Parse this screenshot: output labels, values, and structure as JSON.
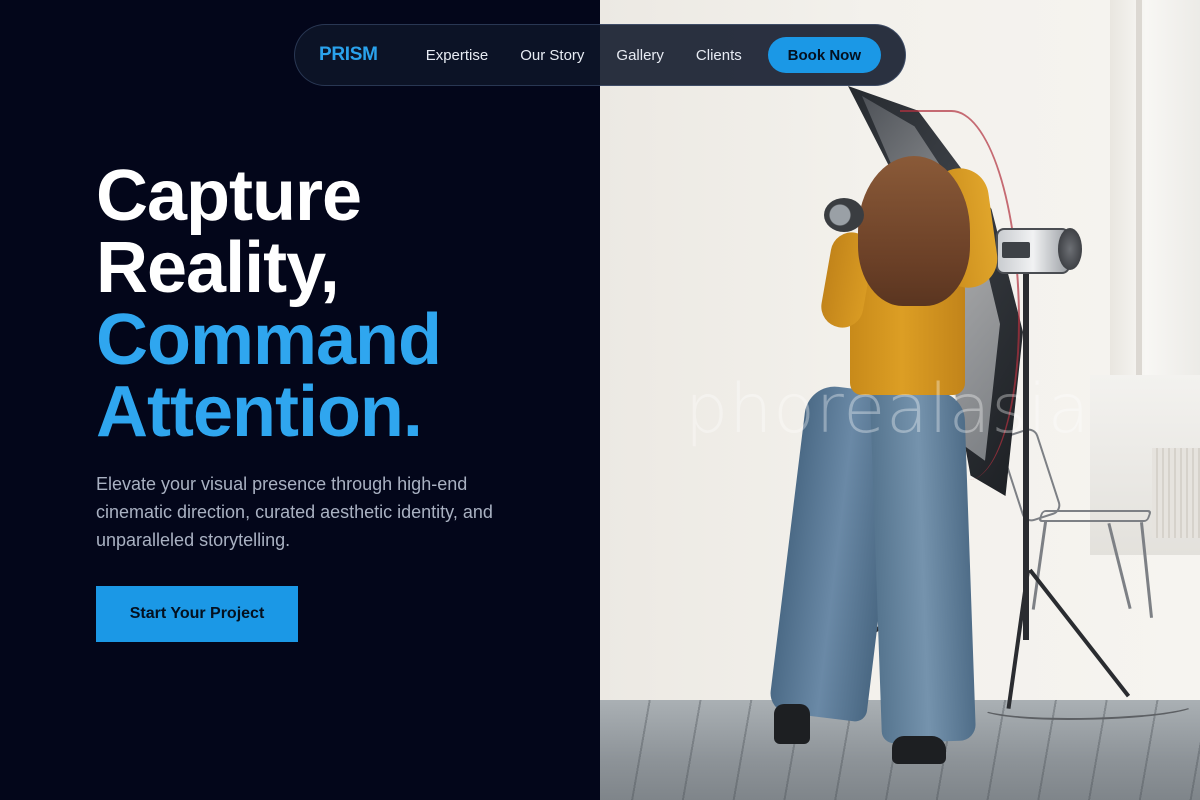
{
  "nav": {
    "brand": "PRISM",
    "links": [
      "Expertise",
      "Our Story",
      "Gallery",
      "Clients"
    ],
    "cta_label": "Book Now"
  },
  "hero": {
    "title_lines": [
      "Capture",
      "Reality,",
      "Command",
      "Attention."
    ],
    "description": "Elevate your visual presence through high-end cinematic direction, curated aesthetic identity, and unparalleled storytelling.",
    "cta_label": "Start Your Project"
  },
  "image": {
    "watermark": "phorealasia"
  },
  "colors": {
    "background": "#03061a",
    "accent": "#1b98e6",
    "accent_text": "#2fa6ef",
    "body_text": "#a9b1c2"
  },
  "icons": []
}
